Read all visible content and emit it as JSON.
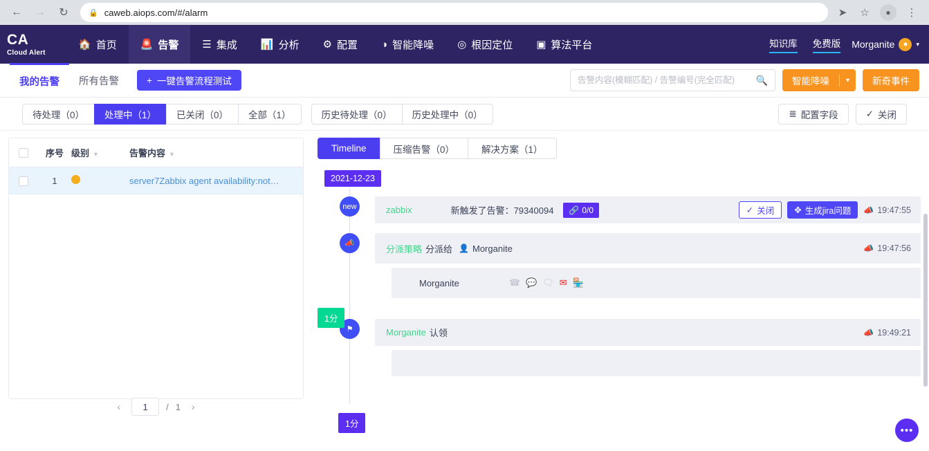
{
  "browser": {
    "url": "caweb.aiops.com/#/alarm",
    "back_icon": "back-arrow-icon",
    "forward_icon": "forward-arrow-icon",
    "reload_icon": "reload-icon",
    "lock_icon": "lock-icon",
    "send_icon": "send-icon",
    "star_icon": "star-icon",
    "profile_icon": "profile-icon",
    "menu_icon": "kebab-menu-icon"
  },
  "navbar": {
    "brand_line1": "CA",
    "brand_line2": "Cloud Alert",
    "items": [
      {
        "label": "首页",
        "icon": "home-icon",
        "active": false
      },
      {
        "label": "告警",
        "icon": "alarm-bell-icon",
        "active": true
      },
      {
        "label": "集成",
        "icon": "layers-icon",
        "active": false
      },
      {
        "label": "分析",
        "icon": "bar-chart-icon",
        "active": false
      },
      {
        "label": "配置",
        "icon": "gear-icon",
        "active": false
      },
      {
        "label": "智能降噪",
        "icon": "noise-icon",
        "active": false
      },
      {
        "label": "根因定位",
        "icon": "target-icon",
        "active": false
      },
      {
        "label": "算法平台",
        "icon": "algorithm-icon",
        "active": false
      }
    ],
    "links": [
      {
        "label": "知识库"
      },
      {
        "label": "免费版"
      }
    ],
    "user": "Morganite",
    "user_initial": "•",
    "caret": "▾"
  },
  "subbar": {
    "tabs": [
      {
        "label": "我的告警",
        "active": true
      },
      {
        "label": "所有告警",
        "active": false
      }
    ],
    "test_button": "一键告警流程测试",
    "test_button_icon": "plus-icon",
    "search_placeholder": "告警内容(模糊匹配) / 告警编号(完全匹配)",
    "search_value": "",
    "search_icon": "search-icon",
    "noise_button": "智能降噪",
    "noise_caret": "⌄",
    "novel_button": "新奇事件"
  },
  "filters": {
    "primary": [
      {
        "label": "待处理（0）",
        "active": false
      },
      {
        "label": "处理中（1）",
        "active": true
      },
      {
        "label": "已关闭（0）",
        "active": false
      },
      {
        "label": "全部（1）",
        "active": false
      }
    ],
    "secondary": [
      {
        "label": "历史待处理（0）"
      },
      {
        "label": "历史处理中（0）"
      }
    ],
    "config_button": "配置字段",
    "config_icon": "sliders-icon",
    "close_button": "关闭",
    "close_icon": "check-icon"
  },
  "table": {
    "headers": [
      "序号",
      "级别",
      "告警内容"
    ],
    "level_filter_icon": "filter-icon",
    "content_filter_icon": "filter-icon",
    "rows": [
      {
        "no": "1",
        "level_color": "#f6ad1c",
        "content": "server7Zabbix agent availability:not…"
      }
    ],
    "pagination": {
      "prev": "‹",
      "page": "1",
      "separator": "/",
      "total": "1",
      "next": "›"
    }
  },
  "timeline_panel": {
    "tabs": [
      {
        "label": "Timeline",
        "active": true
      },
      {
        "label": "压缩告警（0）",
        "active": false
      },
      {
        "label": "解决方案（1）",
        "active": false
      }
    ],
    "date": "2021-12-23",
    "events": [
      {
        "node_label": "new",
        "node_icon": "new-badge",
        "source": "zabbix",
        "text": "新触发了告警：79340094",
        "chip": "0/0",
        "chip_icon": "link-icon",
        "action_close": "关闭",
        "action_close_icon": "check-icon",
        "action_jira": "生成jira问题",
        "action_jira_icon": "jira-icon",
        "time": "19:47:55",
        "time_icon": "megaphone-icon"
      },
      {
        "node_icon": "megaphone-icon",
        "policy": "分派策略",
        "action": "分派给",
        "person_icon": "person-icon",
        "assignee": "Morganite",
        "time": "19:47:56",
        "time_icon": "megaphone-icon",
        "notify_name": "Morganite",
        "channels": [
          {
            "name": "phone-icon",
            "glyph": "☎",
            "active": false
          },
          {
            "name": "sms-icon",
            "glyph": "⬤",
            "active": false
          },
          {
            "name": "wechat-icon",
            "glyph": "⬤⬤",
            "active": false
          },
          {
            "name": "email-icon",
            "glyph": "✉",
            "active": true
          },
          {
            "name": "dingtalk-icon",
            "glyph": "☗",
            "active": false
          }
        ],
        "duration": "1分"
      },
      {
        "node_icon": "flag-icon",
        "actor": "Morganite",
        "action": "认领",
        "time": "19:49:21",
        "time_icon": "megaphone-icon",
        "duration": "1分"
      }
    ]
  },
  "chat": {
    "icon": "chat-bubble-icon",
    "glyph": "•••"
  }
}
